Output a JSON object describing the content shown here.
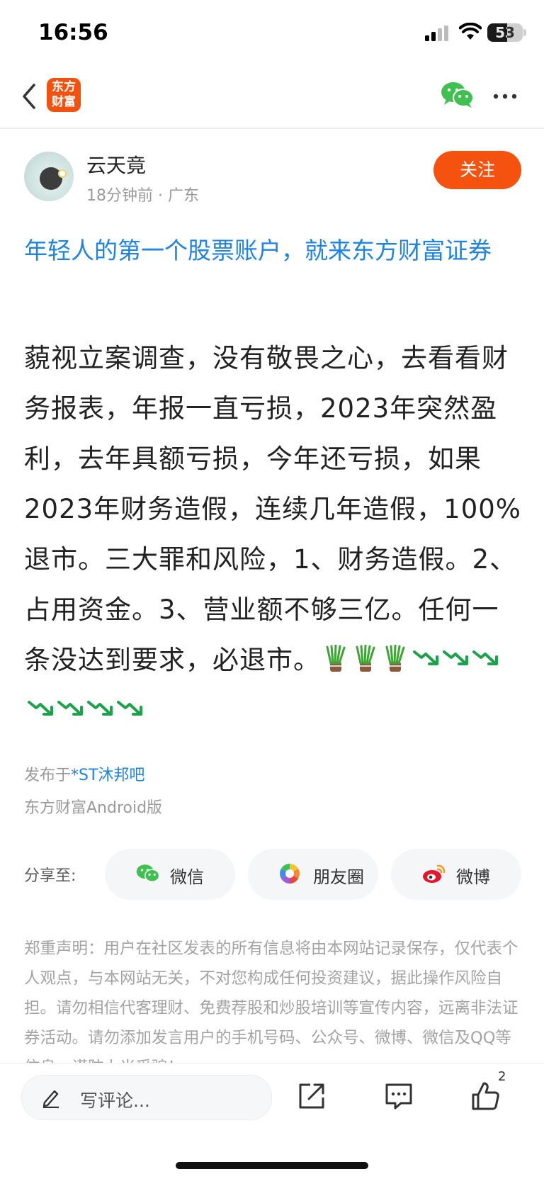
{
  "status_bar": {
    "time": "16:56",
    "battery": "53"
  },
  "nav": {
    "logo_text": "东方\n财富"
  },
  "author": {
    "name": "云天竟",
    "meta": "18分钟前 · 广东",
    "follow_label": "关注"
  },
  "ad_title": "年轻人的第一个股票账户，就来东方财富证券",
  "body_text": "藐视立案调查，没有敬畏之心，去看看财务报表，年报一直亏损，2023年突然盈利，去年具额亏损，今年还亏损，如果2023年财务造假，连续几年造假，100%退市。三大罪和风险，1、财务造假。2、占用资金。3、营业额不够三亿。任何一条没达到要求，必退市。",
  "body_emojis": [
    "leek-icon",
    "leek-icon",
    "leek-icon",
    "down-trend-icon",
    "down-trend-icon",
    "down-trend-icon",
    "down-trend-icon",
    "down-trend-icon",
    "down-trend-icon",
    "down-trend-icon"
  ],
  "post_info": {
    "posted_prefix": "发布于",
    "bar_name": "*ST沐邦吧",
    "client": "东方财富Android版"
  },
  "share": {
    "label": "分享至:",
    "options": [
      {
        "label": "微信",
        "icon": "wechat-icon"
      },
      {
        "label": "朋友圈",
        "icon": "moments-icon"
      },
      {
        "label": "微博",
        "icon": "weibo-icon"
      }
    ]
  },
  "disclaimer": "郑重声明：用户在社区发表的所有信息将由本网站记录保存，仅代表个人观点，与本网站无关，不对您构成任何投资建议，据此操作风险自担。请勿相信代客理财、免费荐股和炒股培训等宣传内容，远离非法证券活动。请勿添加发言用户的手机号码、公众号、微博、微信及QQ等信息，谨防上当受骗！",
  "bottom_bar": {
    "comment_placeholder": "写评论...",
    "like_count": "2"
  },
  "colors": {
    "accent": "#f4520e",
    "link": "#1e83e6",
    "wechat_green": "#3fc050"
  }
}
